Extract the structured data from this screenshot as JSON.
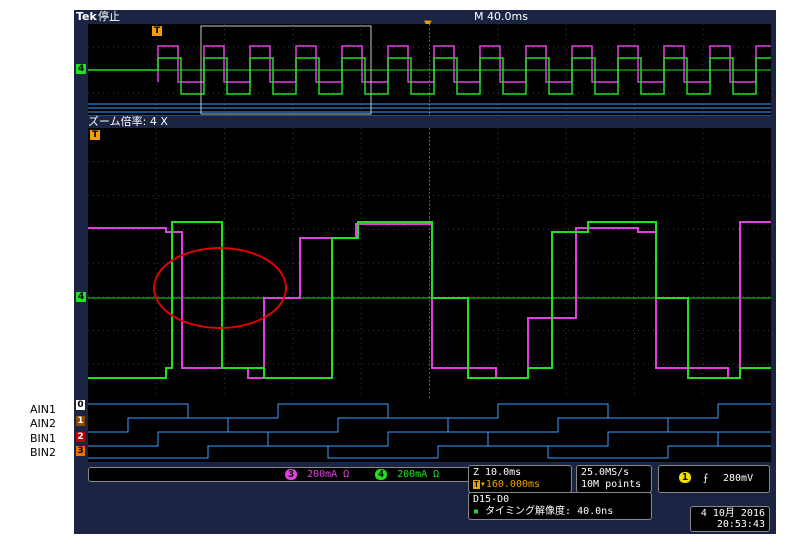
{
  "header": {
    "brand": "Tek",
    "status": "停止",
    "timebase": "M 40.0ms"
  },
  "zoom": {
    "label": "ズーム倍率: 4 X"
  },
  "markers": {
    "trigger": "T",
    "analog_ch4": "4",
    "digital": [
      "0",
      "1",
      "2",
      "3"
    ]
  },
  "signal_labels": [
    "AIN1",
    "AIN2",
    "BIN1",
    "BIN2"
  ],
  "channels": {
    "ch3": {
      "number": "3",
      "scale": "200mA Ω",
      "color": "#e040e0"
    },
    "ch4": {
      "number": "4",
      "scale": "200mA Ω",
      "color": "#20e020"
    }
  },
  "zoom_info": {
    "scale": "Z 10.0ms",
    "position": "▾160.000ms"
  },
  "acquisition": {
    "rate": "25.0MS/s",
    "points": "10M points"
  },
  "trigger_info": {
    "channel": "1",
    "slope": "⨍",
    "level": "280mV"
  },
  "digital_info": {
    "channels": "D15-D0",
    "timing": "タイミング解像度: 40.0ns"
  },
  "datetime": {
    "date": "4 10月 2016",
    "time": "20:53:43"
  },
  "colors": {
    "background": "#1c2444",
    "ch3": "#e040e0",
    "ch4": "#20e020",
    "digital": "#3aa0ff",
    "annotation": "#e00000"
  }
}
